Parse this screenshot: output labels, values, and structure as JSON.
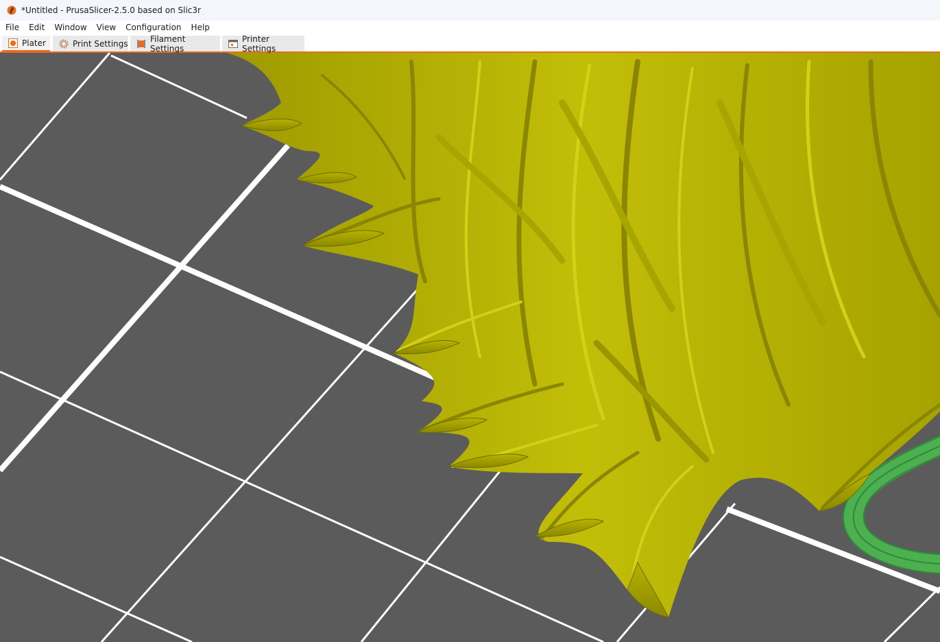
{
  "window": {
    "title": "*Untitled - PrusaSlicer-2.5.0 based on Slic3r",
    "app_icon": "prusa-slicer-logo-icon"
  },
  "menu": {
    "items": [
      "File",
      "Edit",
      "Window",
      "View",
      "Configuration",
      "Help"
    ]
  },
  "tabs": [
    {
      "label": "Plater",
      "icon": "plater-icon",
      "active": true
    },
    {
      "label": "Print Settings",
      "icon": "gear-icon",
      "active": false
    },
    {
      "label": "Filament Settings",
      "icon": "filament-spool-icon",
      "active": false
    },
    {
      "label": "Printer Settings",
      "icon": "printer-icon",
      "active": false
    }
  ],
  "viewport": {
    "background": "#5b5b5b",
    "grid_color": "#ffffff",
    "model_color": "#b8b400",
    "model_shade": "#8f8a00",
    "model_highlight": "#d6d21a",
    "secondary_object_color": "#4caf50",
    "accent": "#ed6b21"
  }
}
